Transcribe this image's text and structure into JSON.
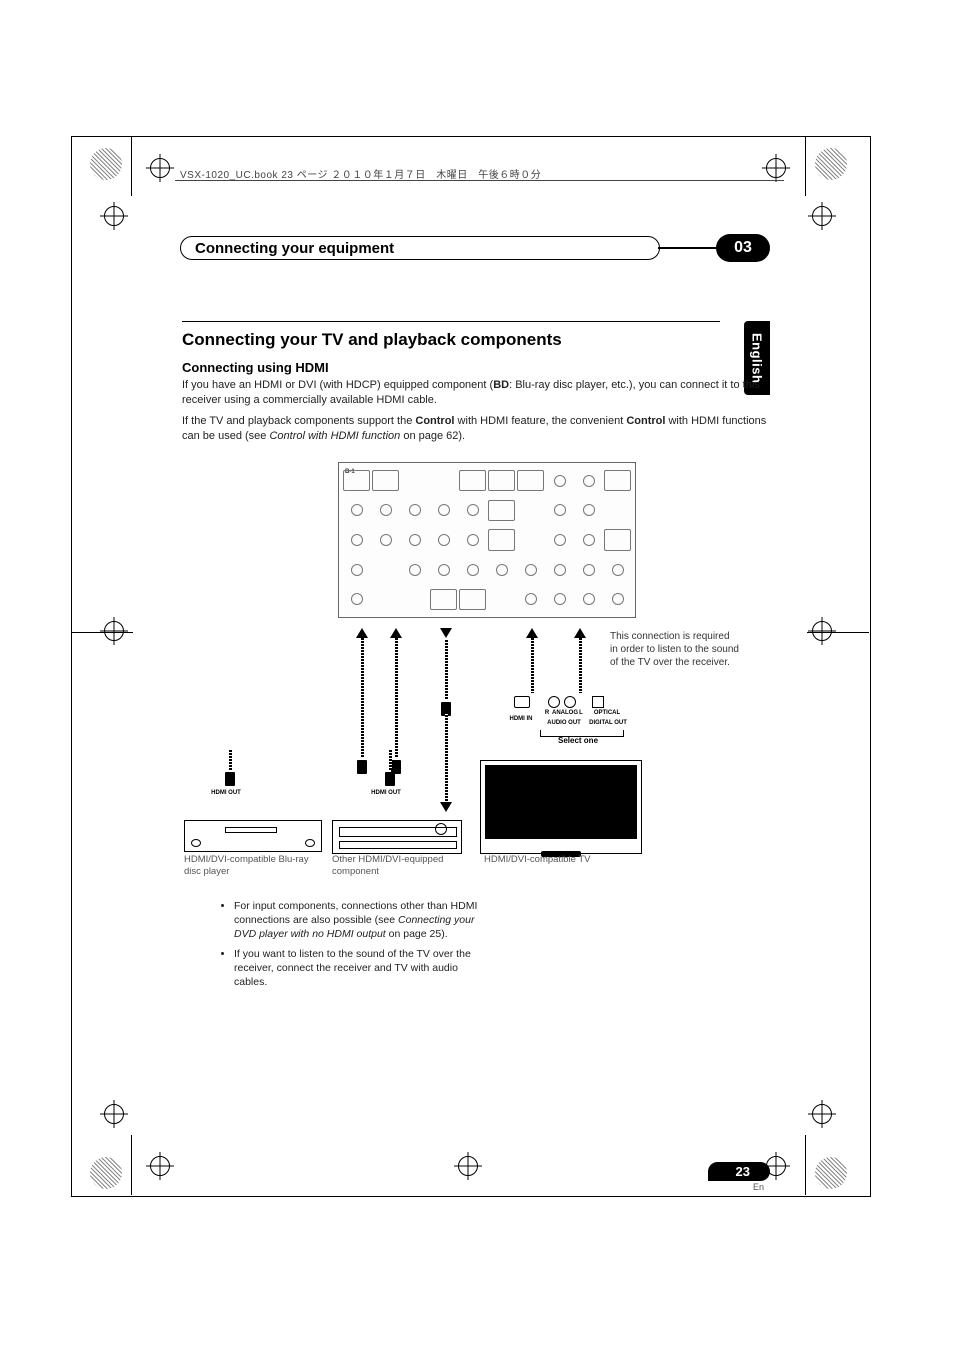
{
  "print_header": "VSX-1020_UC.book  23 ページ  ２０１０年１月７日　木曜日　午後６時０分",
  "chapter": {
    "title": "Connecting your equipment",
    "number": "03"
  },
  "language_tab": "English",
  "section": {
    "title": "Connecting your TV and playback components",
    "subtitle": "Connecting using HDMI",
    "p1_a": "If you have an HDMI or DVI (with HDCP) equipped component (",
    "p1_bd": "BD",
    "p1_b": ": Blu-ray disc player, etc.), you can connect it to this receiver using a commercially available HDMI cable.",
    "p2_a": "If the TV and playback components support the ",
    "p2_ctrl1": "Control",
    "p2_b": " with HDMI feature, the convenient ",
    "p2_ctrl2": "Control",
    "p2_c": " with HDMI functions can be used (see ",
    "p2_ref": "Control with HDMI function",
    "p2_d": " on page 62)."
  },
  "diagram": {
    "note_side": "This connection is required in order to listen to the sound of the TV over the receiver.",
    "select_one": "Select one",
    "port_hdmi_in": "HDMI IN",
    "port_audio_out": "AUDIO OUT",
    "port_analog_r": "R",
    "port_analog": "ANALOG",
    "port_analog_l": "L",
    "port_optical": "OPTICAL",
    "port_digital_out": "DIGITAL OUT",
    "hdmi_out": "HDMI OUT",
    "cap_bd": "HDMI/DVI-compatible Blu-ray disc player",
    "cap_other": "Other HDMI/DVI-equipped component",
    "cap_tv": "HDMI/DVI-compatible TV",
    "panel_corner": "B-1"
  },
  "bullets": {
    "b1_a": "For input components, connections other than HDMI connections are also possible (see ",
    "b1_ref": "Connecting your DVD player with no HDMI output",
    "b1_b": " on page 25).",
    "b2": "If you want to listen to the sound of the TV over the receiver, connect the receiver and TV with audio cables."
  },
  "page": {
    "number": "23",
    "lang": "En"
  }
}
